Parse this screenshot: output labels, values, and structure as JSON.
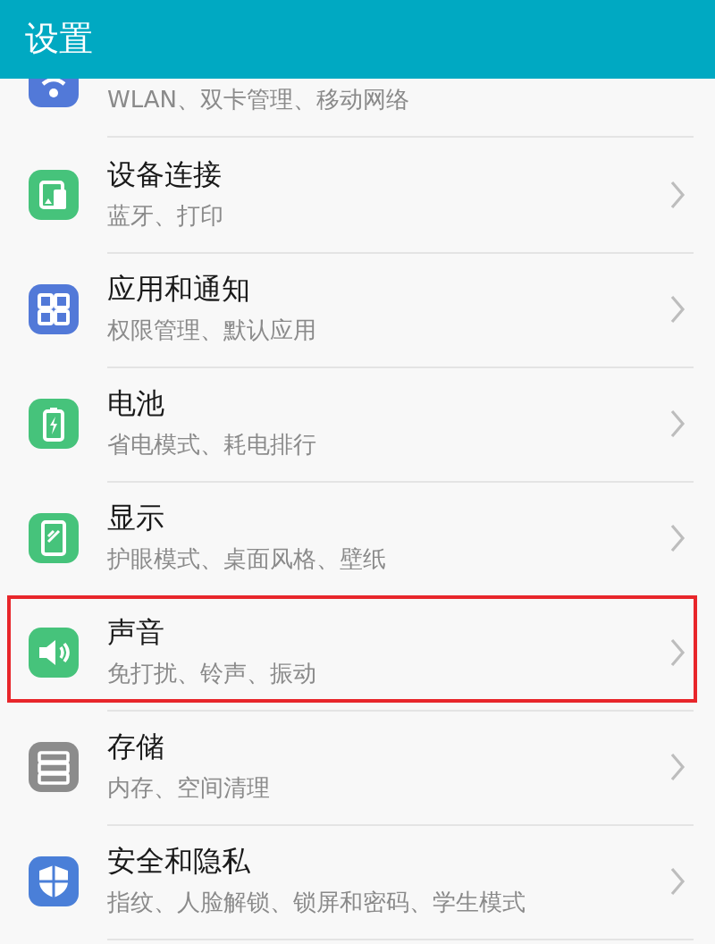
{
  "header": {
    "title": "设置"
  },
  "items": [
    {
      "kind": "wifi",
      "color": "#5279d8",
      "subtitle": "WLAN、双卡管理、移动网络",
      "highlighted": false
    },
    {
      "kind": "devices",
      "color": "#46c37b",
      "title": "设备连接",
      "subtitle": "蓝牙、打印",
      "highlighted": false
    },
    {
      "kind": "apps",
      "color": "#5279d8",
      "title": "应用和通知",
      "subtitle": "权限管理、默认应用",
      "highlighted": false
    },
    {
      "kind": "battery",
      "color": "#46c37b",
      "title": "电池",
      "subtitle": "省电模式、耗电排行",
      "highlighted": false
    },
    {
      "kind": "display",
      "color": "#46c37b",
      "title": "显示",
      "subtitle": "护眼模式、桌面风格、壁纸",
      "highlighted": false
    },
    {
      "kind": "sound",
      "color": "#46c37b",
      "title": "声音",
      "subtitle": "免打扰、铃声、振动",
      "highlighted": true
    },
    {
      "kind": "storage",
      "color": "#8c8c8c",
      "title": "存储",
      "subtitle": "内存、空间清理",
      "highlighted": false
    },
    {
      "kind": "security",
      "color": "#4a7fd8",
      "title": "安全和隐私",
      "subtitle": "指纹、人脸解锁、锁屏和密码、学生模式",
      "highlighted": false
    }
  ]
}
